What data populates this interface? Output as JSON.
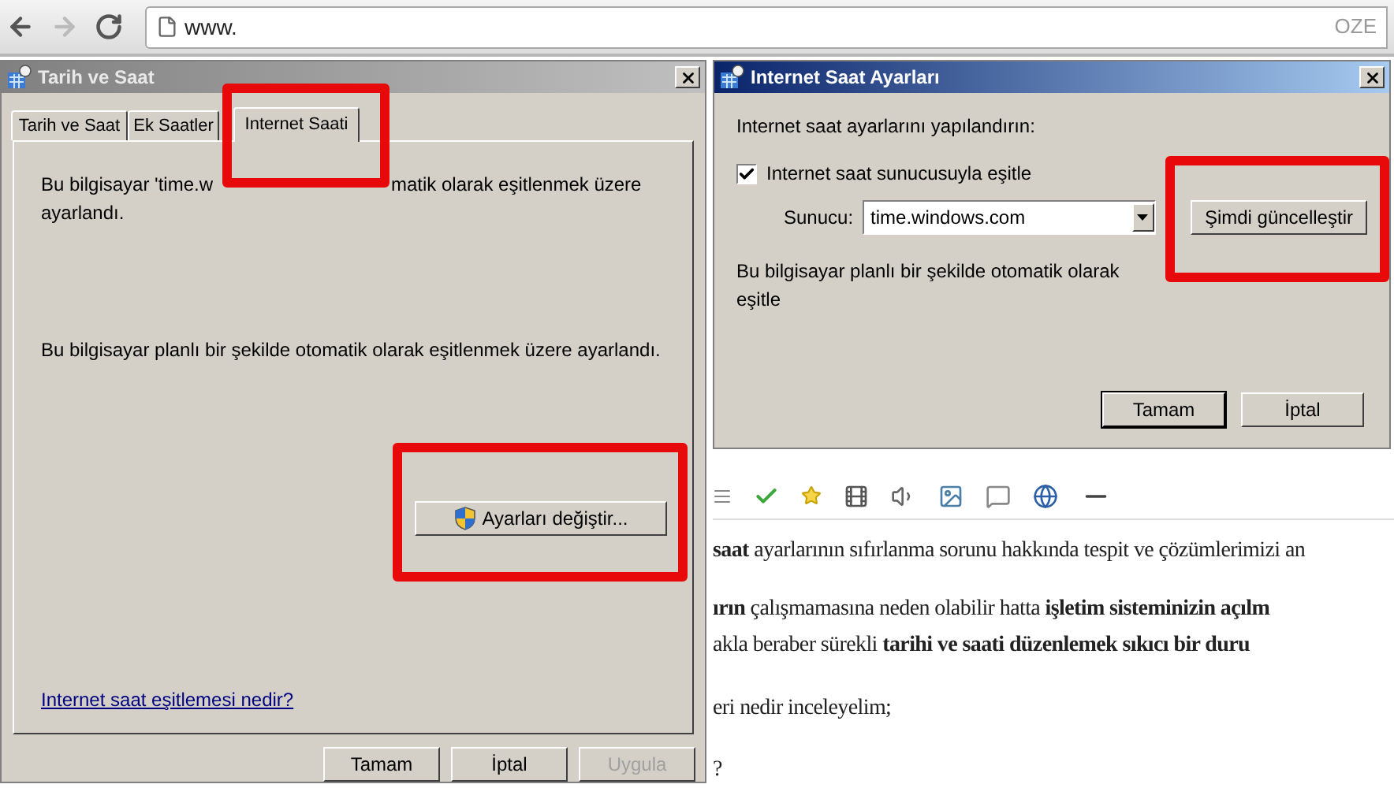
{
  "browser": {
    "address": "www.",
    "address_right": "OZE"
  },
  "date_time_dialog": {
    "title": "Tarih ve Saat",
    "active": false,
    "tabs": [
      {
        "label": "Tarih ve Saat",
        "selected": false
      },
      {
        "label": "Ek Saatler",
        "selected": false
      },
      {
        "label": "Internet Saati",
        "selected": true
      }
    ],
    "status_line_1": [
      "Bu bilgisayar 'time.w",
      "matik olarak eşitlenmek üzere"
    ],
    "status_line_2": "ayarlandı.",
    "schedule_text": "Bu bilgisayar planlı bir şekilde otomatik olarak eşitlenmek üzere ayarlandı.",
    "change_button": "Ayarları değiştir...",
    "help_link": "Internet saat eşitlemesi nedir?",
    "buttons": [
      {
        "label": "Tamam",
        "disabled": false
      },
      {
        "label": "İptal",
        "disabled": false
      },
      {
        "label": "Uygula",
        "disabled": true
      }
    ]
  },
  "internet_time_dialog": {
    "title": "Internet Saat Ayarları",
    "active": true,
    "prompt": "Internet saat ayarlarını yapılandırın:",
    "sync_checkbox": {
      "label": "Internet saat sunucusuyla eşitle",
      "checked": true
    },
    "server_label": "Sunucu:",
    "server": "time.windows.com",
    "update_button": "Şimdi güncelleştir",
    "status_text": "Bu bilgisayar planlı bir şekilde otomatik olarak eşitle",
    "buttons": [
      {
        "label": "Tamam",
        "default": true
      },
      {
        "label": "İptal",
        "default": false
      }
    ]
  },
  "article": {
    "lines": [
      "**saat** ayarlarının sıfırlanma sorunu hakkında tespit ve çözümlerimizi an",
      "**ırın** çalışmamasına neden olabilir hatta **işletim sisteminizin açılm**",
      "akla beraber sürekli **tarihi ve saati düzenlemek sıkıcı bir duru**",
      "eri nedir inceleyelim;",
      "?"
    ]
  }
}
